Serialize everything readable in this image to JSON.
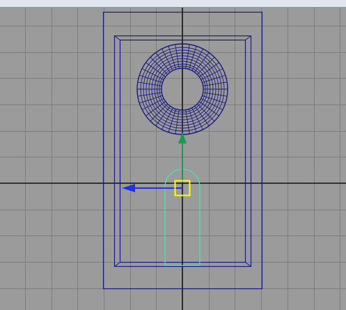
{
  "viewport": {
    "type": "3d-viewport",
    "view": "front",
    "background_color": "#9b9b9b",
    "grid_color": "#7d7d7d",
    "axis_color": "#111111",
    "wireframe_color": "#1a1a80",
    "selection_color": "#4ee0b0",
    "pivot_color": "#ffff00",
    "manipulator_x_color": "#1c32e6",
    "manipulator_y_color": "#1a9a50"
  },
  "objects": [
    {
      "name": "outer-frame",
      "kind": "wireframe-rectangle",
      "selected": false
    },
    {
      "name": "inner-frame",
      "kind": "wireframe-rectangle",
      "selected": false
    },
    {
      "name": "torus",
      "kind": "wireframe-torus",
      "selected": false
    },
    {
      "name": "handle",
      "kind": "capsule-curve",
      "selected": true
    }
  ],
  "manipulator": {
    "tool": "move",
    "axes": [
      "x",
      "y"
    ]
  }
}
